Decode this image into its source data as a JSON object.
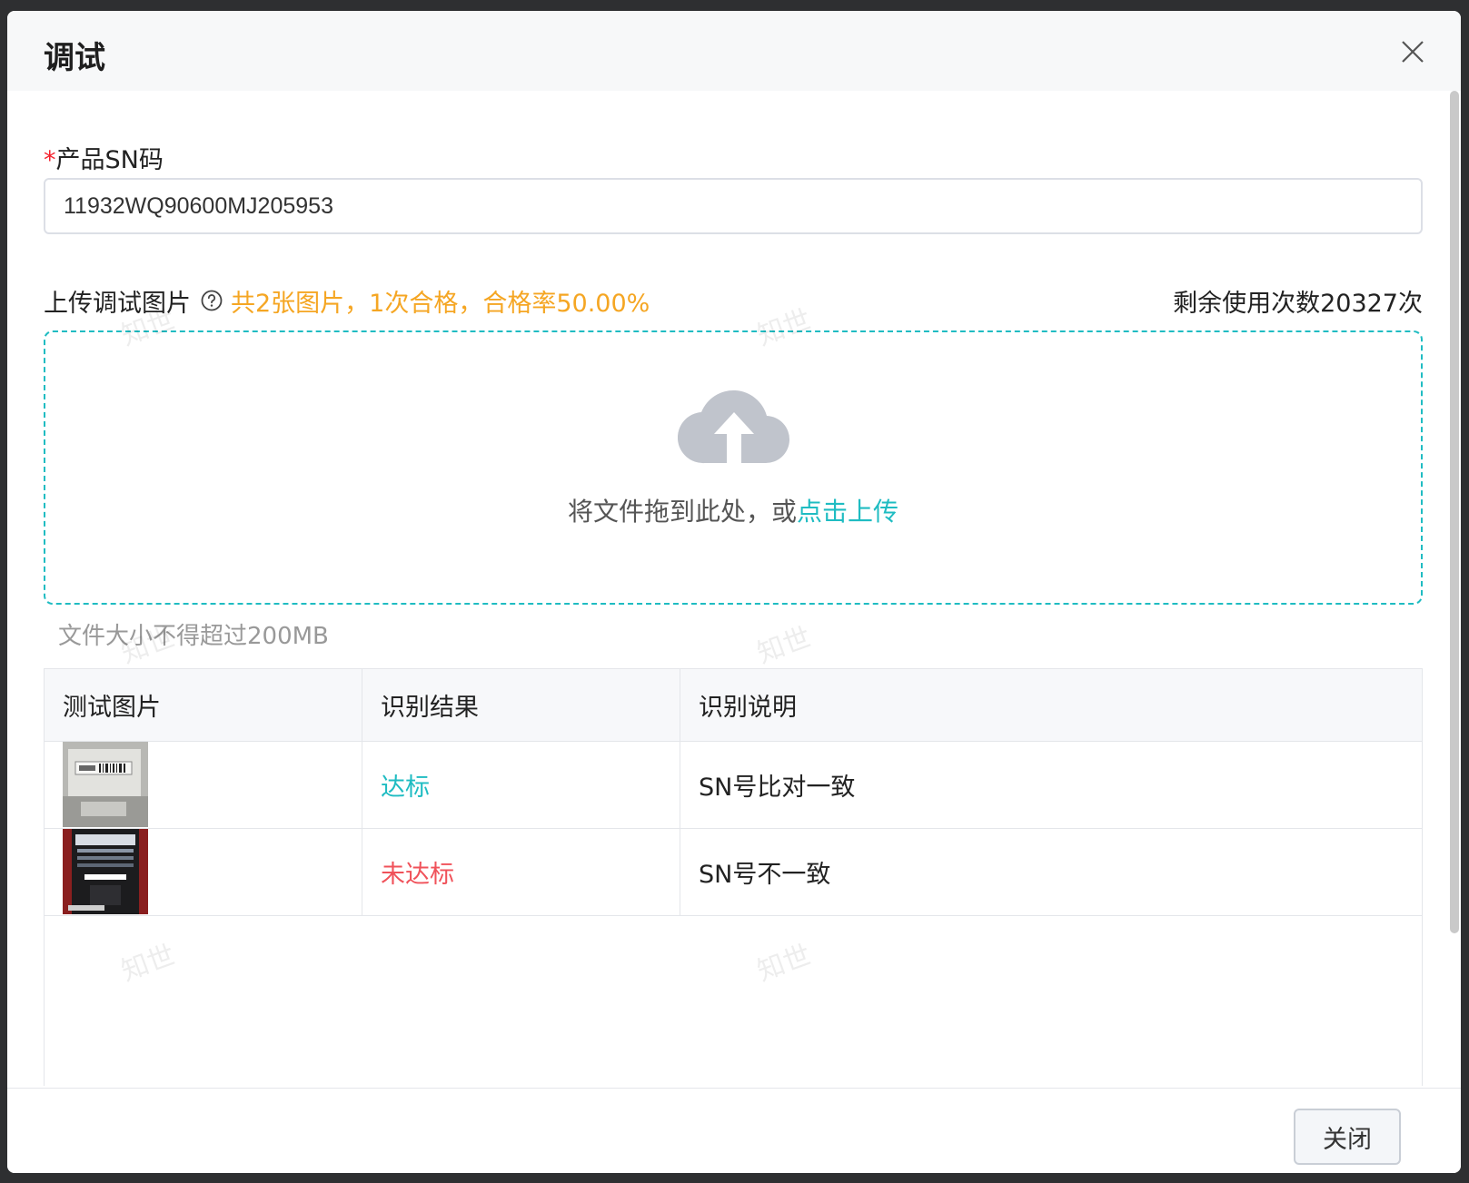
{
  "dialog": {
    "title": "调试",
    "close_icon": "close-icon"
  },
  "form": {
    "sn_required_mark": "*",
    "sn_label": "产品SN码",
    "sn_value": "11932WQ90600MJ205953"
  },
  "upload": {
    "label": "上传调试图片",
    "help_icon": "question-circle-icon",
    "stats": "共2张图片，1次合格，合格率50.00%",
    "remaining": "剩余使用次数20327次",
    "cloud_icon": "cloud-upload-icon",
    "drop_text": "将文件拖到此处，或",
    "drop_link": "点击上传",
    "size_hint": "文件大小不得超过200MB"
  },
  "table": {
    "headers": [
      "测试图片",
      "识别结果",
      "识别说明"
    ],
    "rows": [
      {
        "image": "barcode-label-photo",
        "result": "达标",
        "note": "SN号比对一致"
      },
      {
        "image": "device-rack-photo",
        "result": "未达标",
        "note": "SN号不一致"
      }
    ]
  },
  "footer": {
    "close_label": "关闭"
  },
  "watermark_text": "知世",
  "colors": {
    "accent": "#1fbcc2",
    "warning": "#f5a623",
    "fail": "#f0525a",
    "required": "#f5222d"
  }
}
